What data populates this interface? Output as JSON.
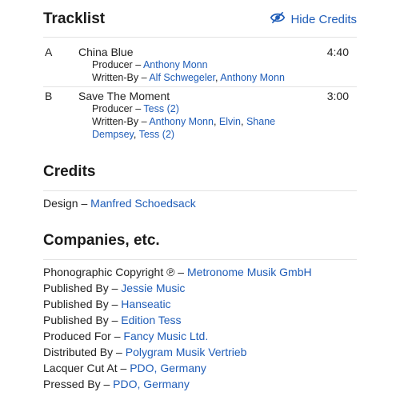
{
  "tracklist": {
    "heading": "Tracklist",
    "hide_credits_label": "Hide Credits",
    "tracks": [
      {
        "position": "A",
        "title": "China Blue",
        "duration": "4:40",
        "credits": [
          {
            "role": "Producer",
            "names": [
              "Anthony Monn"
            ]
          },
          {
            "role": "Written-By",
            "names": [
              "Alf Schwegeler",
              "Anthony Monn"
            ]
          }
        ]
      },
      {
        "position": "B",
        "title": "Save The Moment",
        "duration": "3:00",
        "credits": [
          {
            "role": "Producer",
            "names": [
              "Tess (2)"
            ]
          },
          {
            "role": "Written-By",
            "names": [
              "Anthony Monn",
              "Elvin",
              "Shane Dempsey",
              "Tess (2)"
            ]
          }
        ]
      }
    ]
  },
  "credits": {
    "heading": "Credits",
    "items": [
      {
        "role": "Design",
        "name": "Manfred Schoedsack"
      }
    ]
  },
  "companies": {
    "heading": "Companies, etc.",
    "items": [
      {
        "role": "Phonographic Copyright ℗",
        "name": "Metronome Musik GmbH"
      },
      {
        "role": "Published By",
        "name": "Jessie Music"
      },
      {
        "role": "Published By",
        "name": "Hanseatic"
      },
      {
        "role": "Published By",
        "name": "Edition Tess"
      },
      {
        "role": "Produced For",
        "name": "Fancy Music Ltd."
      },
      {
        "role": "Distributed By",
        "name": "Polygram Musik Vertrieb"
      },
      {
        "role": "Lacquer Cut At",
        "name": "PDO, Germany"
      },
      {
        "role": "Pressed By",
        "name": "PDO, Germany"
      }
    ]
  },
  "separator": " – ",
  "colors": {
    "link": "#1f5db8",
    "text": "#222222",
    "divider": "#e3e3e3"
  }
}
